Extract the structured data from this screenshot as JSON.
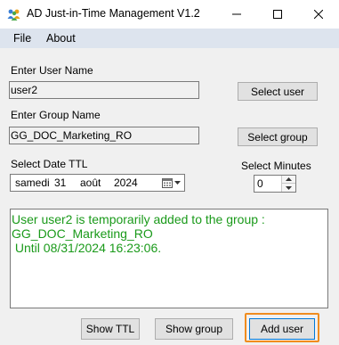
{
  "window": {
    "title": "AD Just-in-Time Management V1.2",
    "accent_highlight_color": "#f08c1e",
    "output_text_color": "#1a9a1a"
  },
  "menu": [
    "File",
    "About"
  ],
  "user_section": {
    "label": "Enter User Name",
    "value": "user2",
    "button_label": "Select user"
  },
  "group_section": {
    "label": "Enter Group Name",
    "value": "GG_DOC_Marketing_RO",
    "button_label": "Select group"
  },
  "date_section": {
    "label": "Select Date TTL",
    "weekday": "samedi",
    "day": "31",
    "month": "août",
    "year": "2024"
  },
  "minutes_section": {
    "label": "Select Minutes",
    "value": "0"
  },
  "output": {
    "lines": [
      "User user2 is temporarily added to the group :",
      "GG_DOC_Marketing_RO",
      " Until 08/31/2024 16:23:06."
    ]
  },
  "buttons": {
    "show_ttl": "Show TTL",
    "show_group": "Show group",
    "add_user": "Add user"
  }
}
